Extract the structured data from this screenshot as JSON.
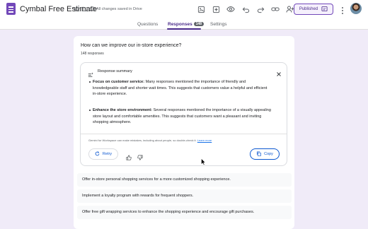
{
  "header": {
    "title": "Cymbal Free Estimate",
    "save_status": "All changes saved in Drive",
    "publish_label": "Published",
    "toolbar_icons": [
      "palette-icon",
      "ai-sparkle-icon",
      "preview-eye-icon",
      "undo-icon",
      "redo-icon",
      "link-icon",
      "add-collaborator-icon"
    ]
  },
  "tabs": [
    {
      "label": "Questions",
      "active": false
    },
    {
      "label": "Responses",
      "active": true,
      "badge": "148"
    },
    {
      "label": "Settings",
      "active": false
    }
  ],
  "main": {
    "question": "How can we improve our in-store experience?",
    "response_count": "148 responses",
    "summary": {
      "title": "Response summary",
      "bullets": [
        {
          "heading": "Focus on customer service:",
          "text": " Many responses mentioned the importance of friendly and knowledgeable staff and shorter wait times. This suggests that customers value a helpful and efficient in-store experience."
        },
        {
          "heading": "Enhance the store environment:",
          "text": " Several responses mentioned the importance of a visually appealing store layout and comfortable amenities. This suggests that customers want a pleasant and inviting shopping atmosphere."
        }
      ],
      "disclaimer": "Gemini for Workspace can make mistakes, including about people, so double-check it.",
      "learn_more": "Learn more",
      "retry_label": "Retry",
      "copy_label": "Copy"
    },
    "responses": [
      "Offer in-store personal shopping services for a more customized shopping experience.",
      "Implement a loyalty program with rewards for frequent shoppers.",
      "Offer free gift wrapping services to enhance the shopping experience and encourage gift purchases."
    ]
  },
  "colors": {
    "background": "#f0ebf8",
    "accent": "#7248b9",
    "accent_dark": "#4a2b8a",
    "link_blue": "#0b57d0"
  }
}
